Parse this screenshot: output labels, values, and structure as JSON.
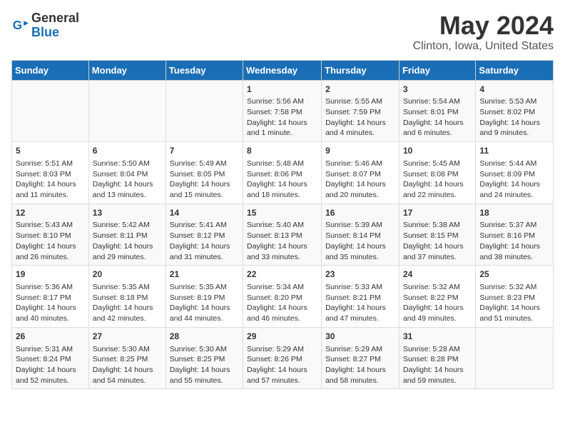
{
  "logo": {
    "line1": "General",
    "line2": "Blue"
  },
  "title": "May 2024",
  "subtitle": "Clinton, Iowa, United States",
  "weekdays": [
    "Sunday",
    "Monday",
    "Tuesday",
    "Wednesday",
    "Thursday",
    "Friday",
    "Saturday"
  ],
  "weeks": [
    [
      {
        "day": "",
        "info": ""
      },
      {
        "day": "",
        "info": ""
      },
      {
        "day": "",
        "info": ""
      },
      {
        "day": "1",
        "info": "Sunrise: 5:56 AM\nSunset: 7:58 PM\nDaylight: 14 hours\nand 1 minute."
      },
      {
        "day": "2",
        "info": "Sunrise: 5:55 AM\nSunset: 7:59 PM\nDaylight: 14 hours\nand 4 minutes."
      },
      {
        "day": "3",
        "info": "Sunrise: 5:54 AM\nSunset: 8:01 PM\nDaylight: 14 hours\nand 6 minutes."
      },
      {
        "day": "4",
        "info": "Sunrise: 5:53 AM\nSunset: 8:02 PM\nDaylight: 14 hours\nand 9 minutes."
      }
    ],
    [
      {
        "day": "5",
        "info": "Sunrise: 5:51 AM\nSunset: 8:03 PM\nDaylight: 14 hours\nand 11 minutes."
      },
      {
        "day": "6",
        "info": "Sunrise: 5:50 AM\nSunset: 8:04 PM\nDaylight: 14 hours\nand 13 minutes."
      },
      {
        "day": "7",
        "info": "Sunrise: 5:49 AM\nSunset: 8:05 PM\nDaylight: 14 hours\nand 15 minutes."
      },
      {
        "day": "8",
        "info": "Sunrise: 5:48 AM\nSunset: 8:06 PM\nDaylight: 14 hours\nand 18 minutes."
      },
      {
        "day": "9",
        "info": "Sunrise: 5:46 AM\nSunset: 8:07 PM\nDaylight: 14 hours\nand 20 minutes."
      },
      {
        "day": "10",
        "info": "Sunrise: 5:45 AM\nSunset: 8:08 PM\nDaylight: 14 hours\nand 22 minutes."
      },
      {
        "day": "11",
        "info": "Sunrise: 5:44 AM\nSunset: 8:09 PM\nDaylight: 14 hours\nand 24 minutes."
      }
    ],
    [
      {
        "day": "12",
        "info": "Sunrise: 5:43 AM\nSunset: 8:10 PM\nDaylight: 14 hours\nand 26 minutes."
      },
      {
        "day": "13",
        "info": "Sunrise: 5:42 AM\nSunset: 8:11 PM\nDaylight: 14 hours\nand 29 minutes."
      },
      {
        "day": "14",
        "info": "Sunrise: 5:41 AM\nSunset: 8:12 PM\nDaylight: 14 hours\nand 31 minutes."
      },
      {
        "day": "15",
        "info": "Sunrise: 5:40 AM\nSunset: 8:13 PM\nDaylight: 14 hours\nand 33 minutes."
      },
      {
        "day": "16",
        "info": "Sunrise: 5:39 AM\nSunset: 8:14 PM\nDaylight: 14 hours\nand 35 minutes."
      },
      {
        "day": "17",
        "info": "Sunrise: 5:38 AM\nSunset: 8:15 PM\nDaylight: 14 hours\nand 37 minutes."
      },
      {
        "day": "18",
        "info": "Sunrise: 5:37 AM\nSunset: 8:16 PM\nDaylight: 14 hours\nand 38 minutes."
      }
    ],
    [
      {
        "day": "19",
        "info": "Sunrise: 5:36 AM\nSunset: 8:17 PM\nDaylight: 14 hours\nand 40 minutes."
      },
      {
        "day": "20",
        "info": "Sunrise: 5:35 AM\nSunset: 8:18 PM\nDaylight: 14 hours\nand 42 minutes."
      },
      {
        "day": "21",
        "info": "Sunrise: 5:35 AM\nSunset: 8:19 PM\nDaylight: 14 hours\nand 44 minutes."
      },
      {
        "day": "22",
        "info": "Sunrise: 5:34 AM\nSunset: 8:20 PM\nDaylight: 14 hours\nand 46 minutes."
      },
      {
        "day": "23",
        "info": "Sunrise: 5:33 AM\nSunset: 8:21 PM\nDaylight: 14 hours\nand 47 minutes."
      },
      {
        "day": "24",
        "info": "Sunrise: 5:32 AM\nSunset: 8:22 PM\nDaylight: 14 hours\nand 49 minutes."
      },
      {
        "day": "25",
        "info": "Sunrise: 5:32 AM\nSunset: 8:23 PM\nDaylight: 14 hours\nand 51 minutes."
      }
    ],
    [
      {
        "day": "26",
        "info": "Sunrise: 5:31 AM\nSunset: 8:24 PM\nDaylight: 14 hours\nand 52 minutes."
      },
      {
        "day": "27",
        "info": "Sunrise: 5:30 AM\nSunset: 8:25 PM\nDaylight: 14 hours\nand 54 minutes."
      },
      {
        "day": "28",
        "info": "Sunrise: 5:30 AM\nSunset: 8:25 PM\nDaylight: 14 hours\nand 55 minutes."
      },
      {
        "day": "29",
        "info": "Sunrise: 5:29 AM\nSunset: 8:26 PM\nDaylight: 14 hours\nand 57 minutes."
      },
      {
        "day": "30",
        "info": "Sunrise: 5:29 AM\nSunset: 8:27 PM\nDaylight: 14 hours\nand 58 minutes."
      },
      {
        "day": "31",
        "info": "Sunrise: 5:28 AM\nSunset: 8:28 PM\nDaylight: 14 hours\nand 59 minutes."
      },
      {
        "day": "",
        "info": ""
      }
    ]
  ]
}
